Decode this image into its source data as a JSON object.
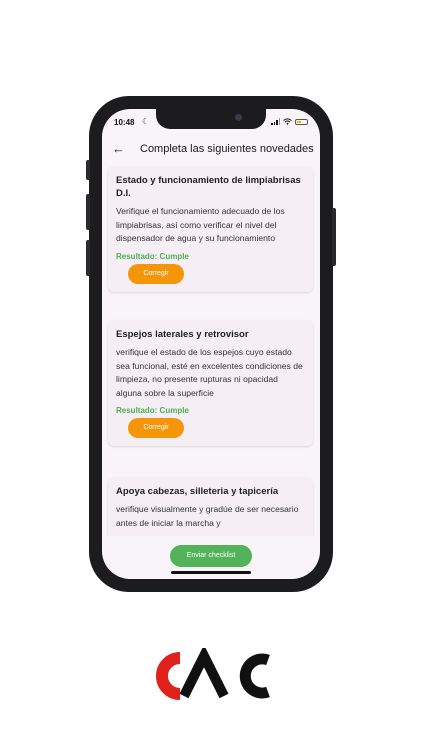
{
  "status_bar": {
    "time": "10:48"
  },
  "header": {
    "title": "Completa las siguientes novedades",
    "back_icon": "arrow-left-icon"
  },
  "items": [
    {
      "title": "Estado y funcionamiento de limpiabrisas D.I.",
      "description": "Verifique el funcionamiento adecuado de los limpiabrisas, así como verificar el nivel del dispensador de agua y su funcionamiento",
      "result": "Resultado: Cumple",
      "button": "Corregir"
    },
    {
      "title": "Espejos laterales y retrovisor",
      "description": "verifique el estado de los espejos cuyo estado sea funcional, esté en excelentes condiciones de limpieza, no presente rupturas ni opacidad alguna sobre la superficie",
      "result": "Resultado: Cumple",
      "button": "Corregir"
    },
    {
      "title": "Apoya cabezas, silleteria y tapicería",
      "description": "verifique visualmente y gradúe de ser necesario antes de iniciar la marcha y"
    }
  ],
  "submit_button": "Enviar checklist",
  "colors": {
    "accent_orange": "#f5960a",
    "success_green": "#4caf50",
    "submit_green": "#52b35a",
    "logo_red": "#e0201b"
  }
}
